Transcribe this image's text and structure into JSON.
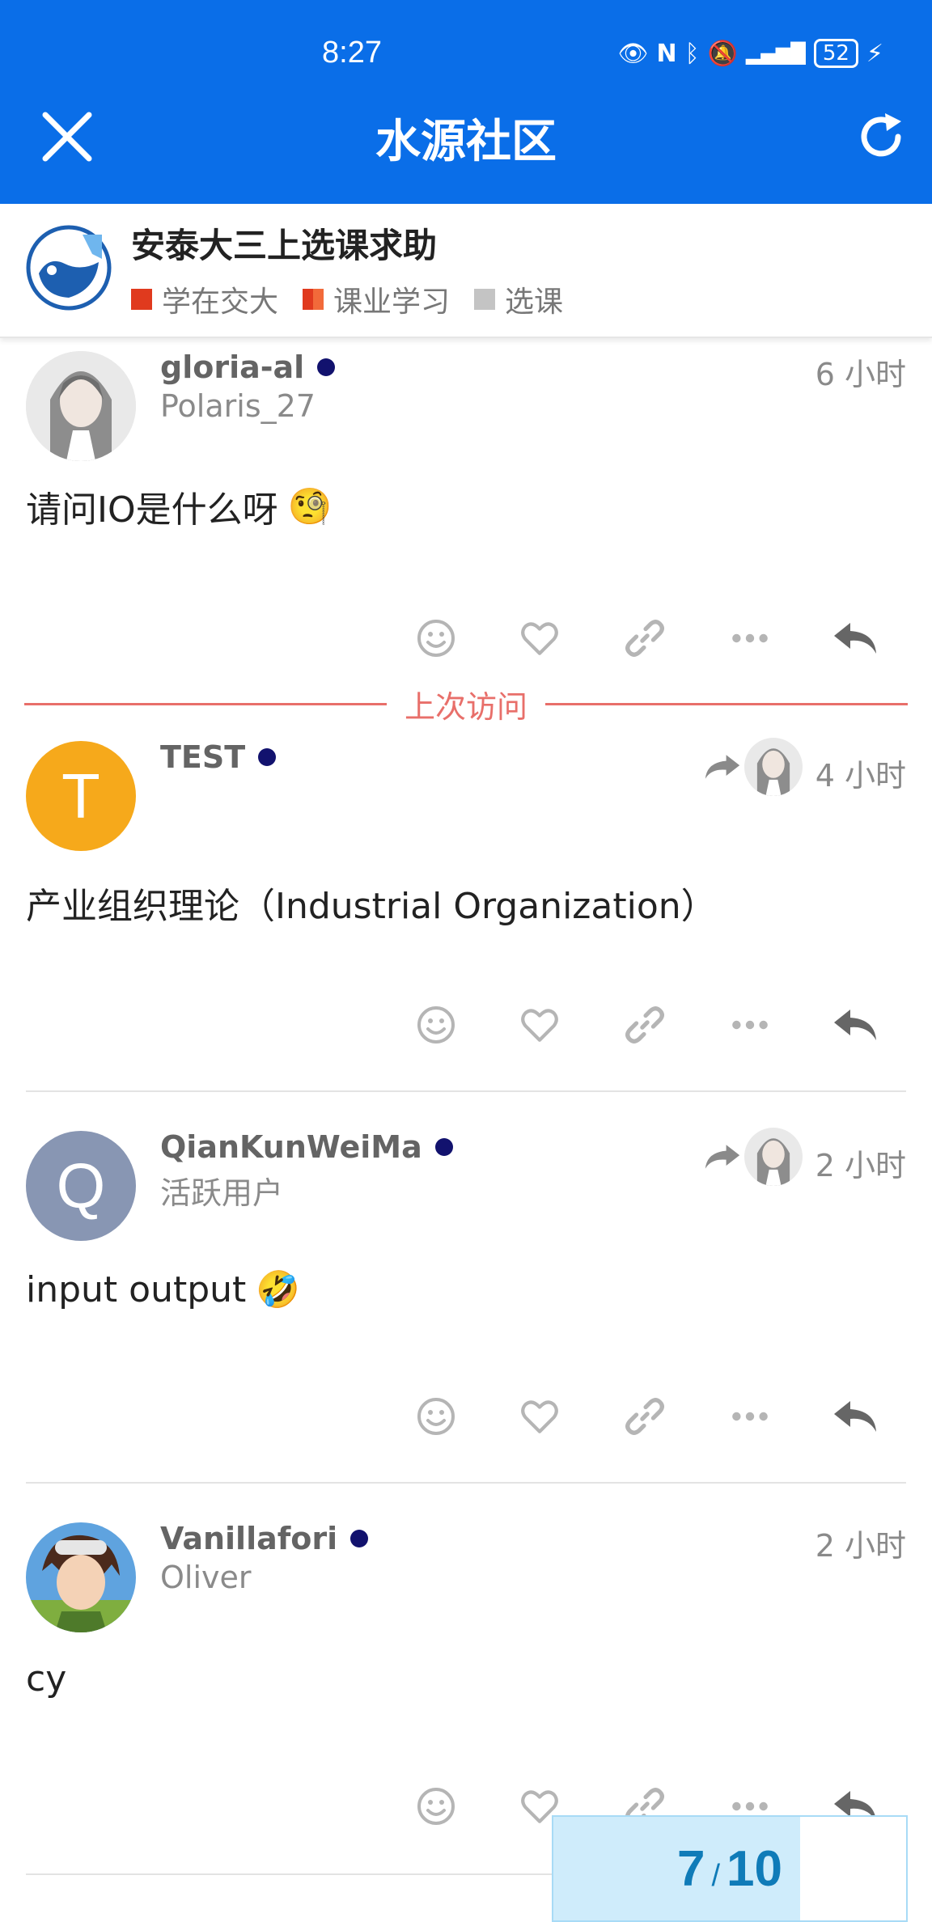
{
  "status_bar": {
    "time": "8:27",
    "battery": "52"
  },
  "header": {
    "title": "水源社区"
  },
  "topic": {
    "title": "安泰大三上选课求助",
    "categories": [
      {
        "label": "学在交大",
        "color": "#e03a1e"
      },
      {
        "label": "课业学习",
        "color": "#f26a3a"
      },
      {
        "label": "选课",
        "color": "#c4c4c4"
      }
    ]
  },
  "last_visit_label": "上次访问",
  "posts": [
    {
      "username": "gloria-al",
      "subname": "Polaris_27",
      "time": "6 小时",
      "body": "请问IO是什么呀",
      "emoji": "🧐"
    },
    {
      "username": "TEST",
      "avatar_letter": "T",
      "avatar_color": "#f6a91b",
      "time": "4 小时",
      "body": "产业组织理论（Industrial Organization）"
    },
    {
      "username": "QianKunWeiMa",
      "subname": "活跃用户",
      "avatar_letter": "Q",
      "avatar_color": "#8896b3",
      "time": "2 小时",
      "body": "input output",
      "emoji": "🤣"
    },
    {
      "username": "Vanillafori",
      "subname": "Oliver",
      "time": "2 小时",
      "body": "cy"
    }
  ],
  "progress": {
    "current": "7",
    "slash": "/",
    "total": "10",
    "fraction": 0.7
  }
}
